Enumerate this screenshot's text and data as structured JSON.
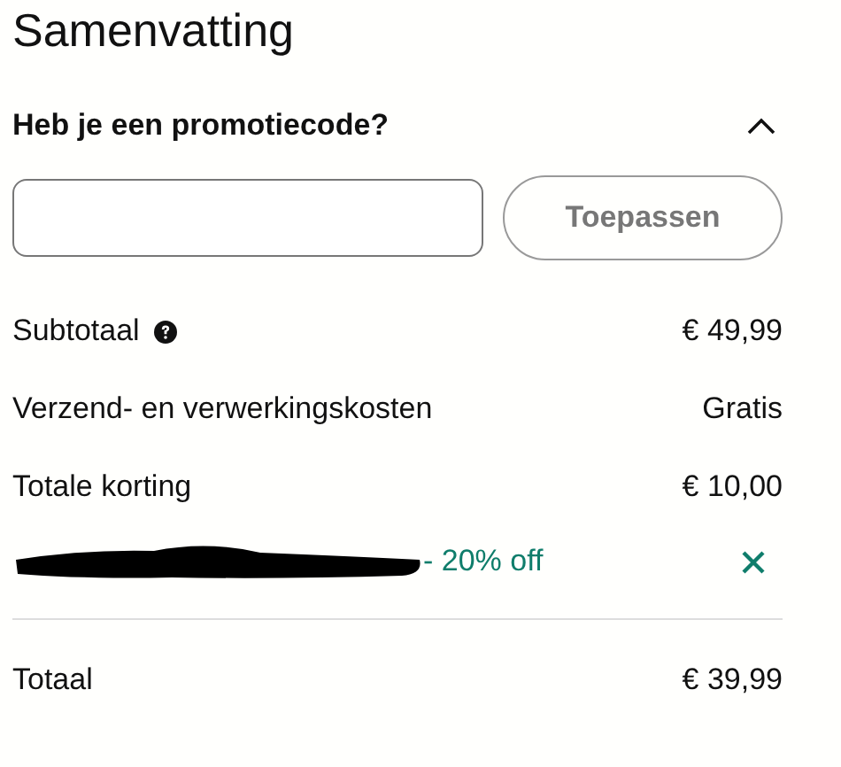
{
  "title": "Samenvatting",
  "promo": {
    "label": "Heb je een promotiecode?",
    "expanded": true,
    "button": "Toepassen"
  },
  "lines": [
    {
      "label": "Subtotaal",
      "help": true,
      "value": "€ 49,99"
    },
    {
      "label": "Verzend- en verwerkingskosten",
      "help": false,
      "value": "Gratis"
    },
    {
      "label": "Totale korting",
      "help": false,
      "value": "€ 10,00"
    }
  ],
  "applied_code": {
    "text": "- 20% off",
    "redacted": true
  },
  "total": {
    "label": "Totaal",
    "value": "€ 39,99"
  }
}
